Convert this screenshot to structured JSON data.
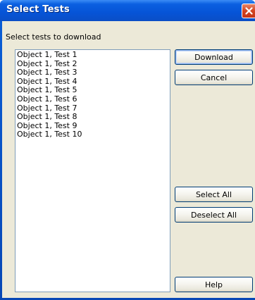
{
  "window": {
    "title": "Select Tests"
  },
  "dialog": {
    "instruction": "Select tests to download",
    "tests": [
      "Object 1, Test 1",
      "Object 1, Test 2",
      "Object 1, Test 3",
      "Object 1, Test 4",
      "Object 1, Test 5",
      "Object 1, Test 6",
      "Object 1, Test 7",
      "Object 1, Test 8",
      "Object 1, Test 9",
      "Object 1, Test 10"
    ]
  },
  "buttons": {
    "download": "Download",
    "cancel": "Cancel",
    "select_all": "Select All",
    "deselect_all": "Deselect All",
    "help": "Help"
  },
  "icons": {
    "close": "close-icon"
  },
  "colors": {
    "titlebar": "#0654d7",
    "close_button": "#d3431f",
    "dialog_background": "#ece9d8",
    "list_border": "#7f9db9",
    "button_border": "#003c74"
  }
}
